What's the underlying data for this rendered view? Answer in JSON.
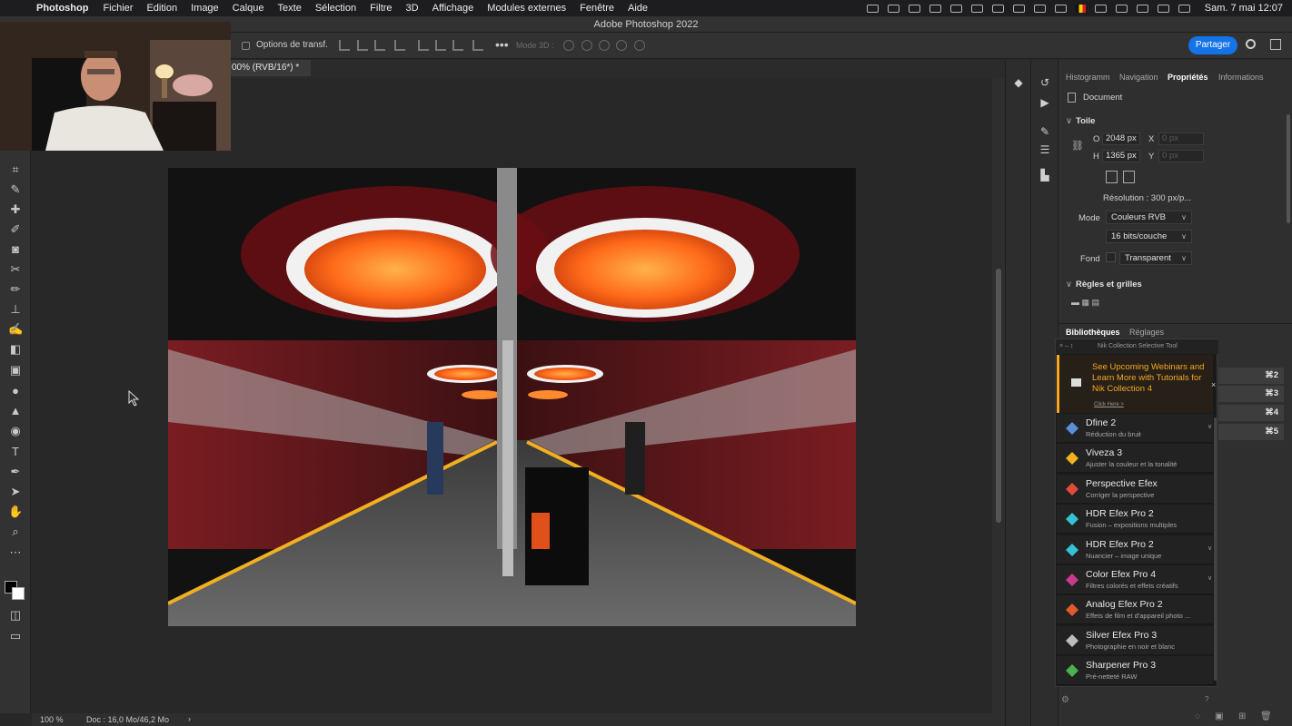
{
  "menubar": {
    "app": "Photoshop",
    "items": [
      "Fichier",
      "Edition",
      "Image",
      "Calque",
      "Texte",
      "Sélection",
      "Filtre",
      "3D",
      "Affichage",
      "Modules externes",
      "Fenêtre",
      "Aide"
    ],
    "clock": "Sam. 7 mai  12:07"
  },
  "window": {
    "title": "Adobe Photoshop 2022"
  },
  "options": {
    "transform_label": "Options de transf.",
    "mode3d_label": "Mode 3D :",
    "share_label": "Partager"
  },
  "document": {
    "tab_label": "00% (RVB/16*) *"
  },
  "status": {
    "zoom": "100 %",
    "doc_info": "Doc : 16,0 Mo/46,2 Mo",
    "arrow": "›"
  },
  "properties": {
    "tabs": [
      "Histogramm",
      "Navigation",
      "Propriétés",
      "Informations"
    ],
    "active_tab": "Propriétés",
    "doc_label": "Document",
    "toile_label": "Toile",
    "width_label": "O",
    "width_value": "2048 px",
    "height_label": "H",
    "height_value": "1365 px",
    "x_label": "X",
    "x_value": "0 px",
    "y_label": "Y",
    "y_value": "0 px",
    "resolution": "Résolution : 300 px/p...",
    "mode_label": "Mode",
    "mode_value": "Couleurs RVB",
    "bits_value": "16 bits/couche",
    "fond_label": "Fond",
    "fond_value": "Transparent",
    "rulers_label": "Règles et grilles"
  },
  "libraries": {
    "tabs": [
      "Bibliothèques",
      "Réglages"
    ],
    "shortcuts": [
      "⌘2",
      "⌘3",
      "⌘4",
      "⌘5"
    ]
  },
  "nik": {
    "header": "Nik Collection Selective Tool",
    "controls": "×  –  ↕",
    "promo_text": "See Upcoming Webinars and Learn More with Tutorials for Nik Collection 4",
    "promo_link": "Click Here >",
    "close": "×",
    "items": [
      {
        "name": "Dfine 2",
        "desc": "Réduction du bruit",
        "color": "#5b8fd6"
      },
      {
        "name": "Viveza 3",
        "desc": "Ajuster la couleur et la tonalité",
        "color": "#f2b31c"
      },
      {
        "name": "Perspective Efex",
        "desc": "Corriger la perspective",
        "color": "#e24b3b"
      },
      {
        "name": "HDR Efex Pro 2",
        "desc": "Fusion – expositions multiples",
        "color": "#35c2d4"
      },
      {
        "name": "HDR Efex Pro 2",
        "desc": "Nuancier – image unique",
        "color": "#35c2d4"
      },
      {
        "name": "Color Efex Pro 4",
        "desc": "Filtres colorés et effets créatifs",
        "color": "#c93a8f"
      },
      {
        "name": "Analog Efex Pro 2",
        "desc": "Effets de film et d'appareil photo ...",
        "color": "#e05a2b"
      },
      {
        "name": "Silver Efex Pro 3",
        "desc": "Photographie en noir et blanc",
        "color": "#bdbdbd"
      },
      {
        "name": "Sharpener Pro 3",
        "desc": "Pré-netteté RAW",
        "color": "#4caf50"
      }
    ]
  },
  "colors": {
    "accent": "#1473e6",
    "promo": "#f5a623",
    "bg": "#282828"
  }
}
